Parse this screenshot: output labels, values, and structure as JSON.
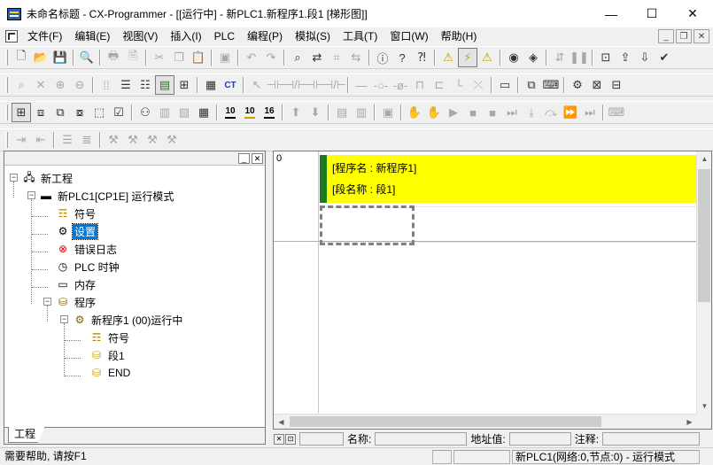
{
  "window": {
    "title": "未命名标题 - CX-Programmer - [[运行中] - 新PLC1.新程序1.段1 [梯形图]]",
    "minimize": "—",
    "maximize": "☐",
    "close": "✕"
  },
  "menubar": {
    "items": [
      "文件(F)",
      "编辑(E)",
      "视图(V)",
      "插入(I)",
      "PLC",
      "编程(P)",
      "模拟(S)",
      "工具(T)",
      "窗口(W)",
      "帮助(H)"
    ],
    "mdi_minimize": "_",
    "mdi_restore": "❐",
    "mdi_close": "✕"
  },
  "toolbars": {
    "row1": [
      "new-icon",
      "open-icon",
      "save-icon",
      "|",
      "print-preview-icon",
      "|",
      "print-icon",
      "page-setup-icon",
      "|",
      "cut-icon",
      "copy-icon",
      "paste-icon",
      "|",
      "delete-icon",
      "|",
      "undo-icon",
      "redo-icon",
      "|",
      "find-icon",
      "replace-icon",
      "find-address-icon",
      "replace-address-icon",
      "|",
      "info-icon",
      "help-icon",
      "context-help-icon",
      "|",
      "warning-icon",
      "online-icon",
      "online-edit-icon",
      "|",
      "monitor-icon",
      "program-mode-icon",
      "|",
      "transfer-icon",
      "pause-icon",
      "|",
      "compare-icon",
      "upload-icon",
      "download-icon",
      "verify-icon"
    ],
    "row2": [
      "zoom-icon",
      "select-icon",
      "zoom-in-icon",
      "zoom-out-icon",
      "|",
      "grid-icon",
      "comment-icon",
      "list-icon",
      "rung-icon",
      "tree-icon",
      "|",
      "smart-input-icon",
      "ct-icon",
      "|",
      "pointer-icon",
      "contact-no-icon",
      "contact-nc-icon",
      "contact-or-icon",
      "contact-ornc-icon",
      "|",
      "line-h-icon",
      "coil-icon",
      "coil-nc-icon",
      "instruction-icon",
      "branch-icon",
      "line-v-icon",
      "line-up-icon",
      "|",
      "monitor-toggle-icon",
      "|",
      "window-icon",
      "keyboard-icon",
      "|",
      "settings-icon",
      "delete-rung-icon",
      "toggle-icon"
    ],
    "row3": [
      "tree-toggle-icon",
      "output-window-icon",
      "watch-icon",
      "xref-icon",
      "address-icon",
      "properties-icon",
      "|",
      "io-table-icon",
      "memory-icon",
      "card-icon",
      "display-icon",
      "|",
      "ten-a-icon",
      "ten-b-icon",
      "sixteen-icon",
      "|",
      "step-up-icon",
      "step-down-icon",
      "|",
      "list-view-icon",
      "mnemonic-icon",
      "|",
      "sim-icon",
      "|",
      "run-icon",
      "pause-sim-icon",
      "play-icon",
      "stop-icon",
      "stop2-icon",
      "step-icon",
      "step-in-icon",
      "step-over-icon",
      "fast-forward-icon",
      "end-icon",
      "|",
      "keyboard2-icon"
    ],
    "row4": [
      "indent-icon",
      "outdent-icon",
      "|",
      "align-icon",
      "align2-icon",
      "|",
      "force-on-icon",
      "force-off-icon",
      "force-cancel-icon",
      "force-clear-icon"
    ],
    "num_ten_a": "10",
    "num_ten_b": "10",
    "num_sixteen": "16"
  },
  "project_tree": {
    "header_btns": [
      "_",
      "✕"
    ],
    "nodes": {
      "root": "新工程",
      "plc": "新PLC1[CP1E] 运行模式",
      "symbols": "符号",
      "settings": "设置",
      "error_log": "错误日志",
      "plc_clock": "PLC 时钟",
      "memory": "内存",
      "programs": "程序",
      "program1": "新程序1 (00)运行中",
      "prog_symbols": "符号",
      "section1": "段1",
      "end": "END"
    },
    "tab": "工程"
  },
  "ladder": {
    "rung_number": "0",
    "program_name_line": "[程序名 : 新程序1]",
    "section_name_line": "[段名称 : 段1]",
    "accent": "#ffff00",
    "bar_color": "#1e7a1e"
  },
  "infobar": {
    "name_label": "名称:",
    "address_label": "地址值:",
    "comment_label": "注释:"
  },
  "statusbar": {
    "help": "需要帮助, 请按F1",
    "plc_status": "新PLC1(网络:0,节点:0) - 运行模式"
  }
}
